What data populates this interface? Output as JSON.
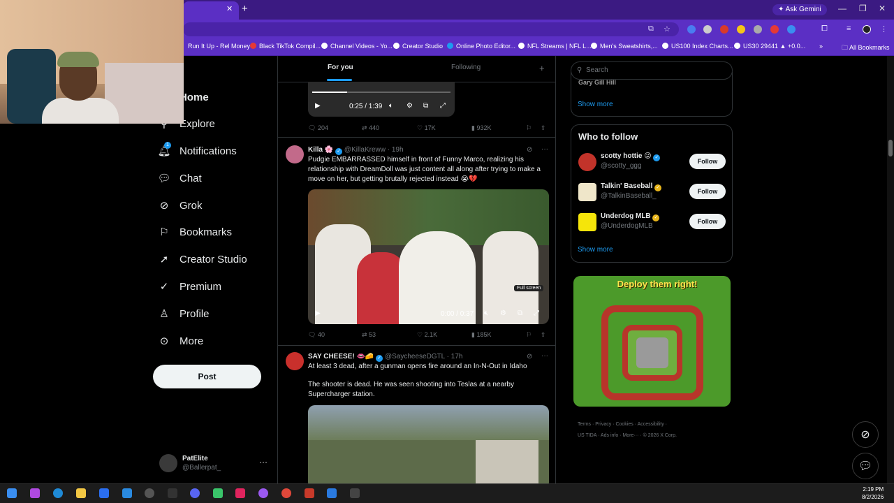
{
  "browser": {
    "ask_gemini": "Ask Gemini",
    "bookmarks": [
      "Run It Up - Rel Money",
      "Black TikTok Compil...",
      "Channel Videos - Yo...",
      "Creator Studio",
      "Online Photo Editor...",
      "NFL Streams | NFL L...",
      "Men's Sweatshirts,...",
      "US100 Index Charts...",
      "US30 29441 ▲ +0.0..."
    ],
    "all_bookmarks": "All Bookmarks"
  },
  "nav": {
    "items": [
      {
        "label": "Home",
        "icon": "home-icon"
      },
      {
        "label": "Explore",
        "icon": "search-icon"
      },
      {
        "label": "Notifications",
        "icon": "bell-icon",
        "badge": "1"
      },
      {
        "label": "Chat",
        "icon": "chat-icon"
      },
      {
        "label": "Grok",
        "icon": "grok-icon"
      },
      {
        "label": "Bookmarks",
        "icon": "bookmark-icon"
      },
      {
        "label": "Creator Studio",
        "icon": "rocket-icon"
      },
      {
        "label": "Premium",
        "icon": "verified-icon"
      },
      {
        "label": "Profile",
        "icon": "person-icon"
      },
      {
        "label": "More",
        "icon": "more-circle-icon"
      }
    ],
    "post_label": "Post"
  },
  "account": {
    "name": "PatElite",
    "handle": "@Ballerpat_"
  },
  "feed": {
    "tabs": [
      "For you",
      "Following"
    ],
    "video1": {
      "time": "0:25 / 1:39"
    },
    "tweet0_actions": {
      "replies": "204",
      "reposts": "440",
      "likes": "17K",
      "views": "932K"
    },
    "tweet1": {
      "name": "Killa 🌸",
      "handle": "@KillaKreww",
      "time": "· 19h",
      "text": "Pudgie EMBARRASSED himself in front of Funny Marco, realizing his relationship with DreamDoll was just content all along after trying to make a move on her, but getting brutally rejected instead 😭💔",
      "video_time": "0:00 / 0:37",
      "tooltip": "Full screen",
      "actions": {
        "replies": "40",
        "reposts": "53",
        "likes": "2.1K",
        "views": "185K"
      }
    },
    "tweet2": {
      "name": "SAY CHEESE! 👄🧀",
      "handle": "@SaycheeseDGTL",
      "time": "· 17h",
      "line1": "At least 3 dead, after a gunman opens fire around an In-N-Out in Idaho",
      "line2": "The shooter is dead. He was seen shooting into Teslas at a nearby Supercharger station."
    }
  },
  "right": {
    "search_placeholder": "Search",
    "trend_cut": "Gary Gill Hill",
    "show_more": "Show more",
    "who_to_follow": "Who to follow",
    "suggestions": [
      {
        "name": "scotty hottie 😜",
        "handle": "@scotty_ggg",
        "follow": "Follow"
      },
      {
        "name": "Talkin' Baseball",
        "handle": "@TalkinBaseball_",
        "follow": "Follow"
      },
      {
        "name": "Underdog MLB",
        "handle": "@UnderdogMLB",
        "follow": "Follow"
      }
    ],
    "ad_title": "Deploy them right!",
    "footer1": "Terms · Privacy · Cookies · Accessibility ·",
    "footer2": "US TIDA · Ads info · More··· · © 2026 X Corp."
  },
  "taskbar": {
    "time": "2:19 PM",
    "date": "8/2/2026"
  },
  "colors": {
    "accent": "#1d9bf0",
    "browser_purple": "#5b2fc4"
  }
}
